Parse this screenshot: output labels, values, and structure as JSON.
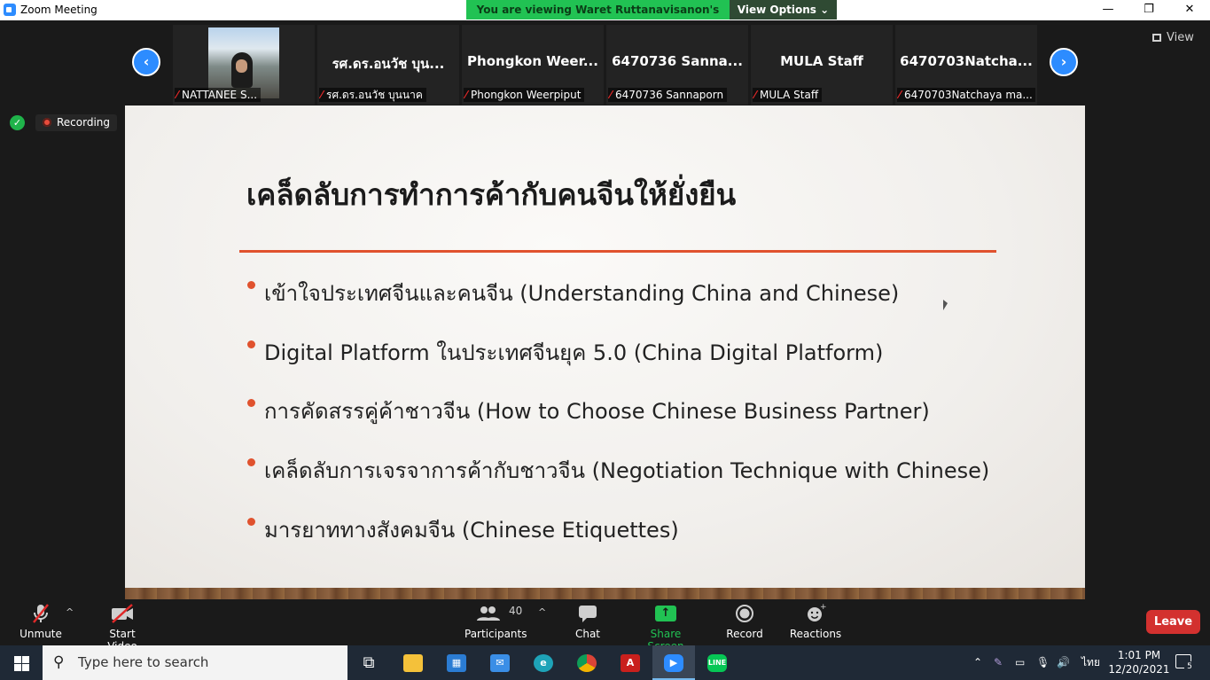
{
  "window": {
    "title": "Zoom Meeting",
    "share_banner": "You are viewing Waret Ruttanavisanon's screen",
    "view_options": "View Options",
    "minimize": "—",
    "restore": "❐",
    "close": "✕"
  },
  "gallery": {
    "prev": "‹",
    "next": "›",
    "view_label": "View",
    "participants": [
      {
        "big_name": "",
        "label": "NATTANEE S...",
        "has_photo": true
      },
      {
        "big_name": "รศ.ดร.อนวัช บุน...",
        "label": "รศ.ดร.อนวัช บุนนาค"
      },
      {
        "big_name": "Phongkon  Weer...",
        "label": "Phongkon Weerpiput"
      },
      {
        "big_name": "6470736 Sanna...",
        "label": "6470736 Sannaporn"
      },
      {
        "big_name": "MULA Staff",
        "label": "MULA Staff"
      },
      {
        "big_name": "6470703Natcha...",
        "label": "6470703Natchaya ma..."
      }
    ]
  },
  "status": {
    "recording": "Recording"
  },
  "slide": {
    "title": "เคล็ดลับการทำการค้ากับคนจีนให้ยั่งยืน",
    "bullets": [
      "เข้าใจประเทศจีนและคนจีน (Understanding China and Chinese)",
      "Digital Platform ในประเทศจีนยุค 5.0 (China Digital Platform)",
      "การคัดสรรคู่ค้าชาวจีน (How to Choose Chinese Business Partner)",
      "เคล็ดลับการเจรจาการค้ากับชาวจีน (Negotiation Technique with Chinese)",
      "มารยาททางสังคมจีน (Chinese Etiquettes)"
    ],
    "accent_color": "#e0522e"
  },
  "toolbar": {
    "unmute": "Unmute",
    "start_video": "Start Video",
    "participants": "Participants",
    "participant_count": "40",
    "chat": "Chat",
    "share_screen": "Share Screen",
    "record": "Record",
    "reactions": "Reactions",
    "leave": "Leave"
  },
  "taskbar": {
    "search_placeholder": "Type here to search",
    "lang": "ไทย",
    "time": "1:01 PM",
    "date": "12/20/2021",
    "notifications": "5"
  }
}
